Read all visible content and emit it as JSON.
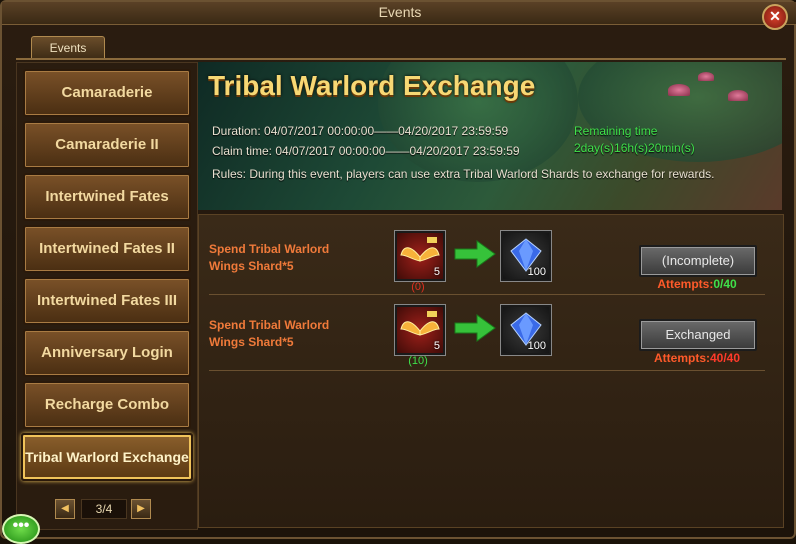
{
  "window": {
    "title": "Events",
    "close_icon": "close-icon"
  },
  "tabs": [
    {
      "label": "Events"
    }
  ],
  "sidebar": {
    "items": [
      {
        "label": "Camaraderie",
        "active": false
      },
      {
        "label": "Camaraderie II",
        "active": false
      },
      {
        "label": "Intertwined Fates",
        "active": false
      },
      {
        "label": "Intertwined Fates II",
        "active": false
      },
      {
        "label": "Intertwined Fates III",
        "active": false
      },
      {
        "label": "Anniversary Login",
        "active": false
      },
      {
        "label": "Recharge Combo",
        "active": false
      },
      {
        "label": "Tribal Warlord Exchange",
        "active": true
      }
    ],
    "pager": {
      "prev_icon": "arrow-left-icon",
      "text": "3/4",
      "next_icon": "arrow-right-icon"
    }
  },
  "event": {
    "title": "Tribal Warlord Exchange",
    "duration": "Duration: 04/07/2017 00:00:00——04/20/2017 23:59:59",
    "claim_time": "Claim time: 04/07/2017 00:00:00——04/20/2017 23:59:59",
    "remaining_label": "Remaining time",
    "remaining_value": "2day(s)16h(s)20min(s)",
    "rules": "Rules: During this event, players can use extra Tribal Warlord Shards to exchange for rewards."
  },
  "exchanges": [
    {
      "label": "Spend Tribal Warlord Wings Shard*5",
      "cost_icon": "wings-shard-icon",
      "cost_count": "5",
      "owned": "(0)",
      "owned_color": "#e03020",
      "reward_icon": "diamond-icon",
      "reward_count": "100",
      "button_label": "(Incomplete)",
      "attempts_prefix": "Attempts:",
      "attempts_value": "0/40",
      "attempts_value_color": "#3fe04a"
    },
    {
      "label": "Spend Tribal Warlord Wings Shard*5",
      "cost_icon": "wings-shard-icon",
      "cost_count": "5",
      "owned": "(10)",
      "owned_color": "#3fe04a",
      "reward_icon": "diamond-icon",
      "reward_count": "100",
      "button_label": "Exchanged",
      "attempts_prefix": "Attempts:",
      "attempts_value": "40/40",
      "attempts_value_color": "#ff3a2a"
    }
  ],
  "chat": {
    "icon": "chat-bubble-icon",
    "text": "•••"
  },
  "colors": {
    "accent_title": "#f7d874",
    "label_orange": "#f07a3a",
    "green": "#3fe04a",
    "red": "#e03020"
  }
}
